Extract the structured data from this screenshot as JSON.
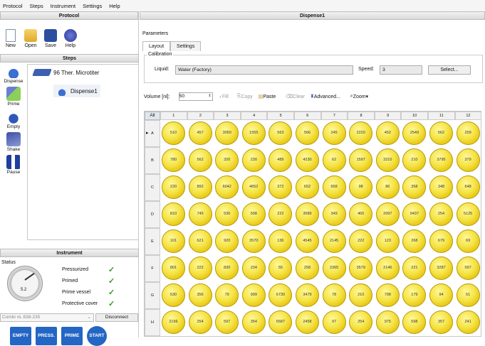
{
  "menu": [
    "Protocol",
    "Steps",
    "Instrument",
    "Settings",
    "Help"
  ],
  "left": {
    "protocol_title": "Protocol",
    "tools": [
      {
        "label": "New",
        "icon": "new-file-icon"
      },
      {
        "label": "Open",
        "icon": "open-folder-icon"
      },
      {
        "label": "Save",
        "icon": "save-disk-icon"
      },
      {
        "label": "Help",
        "icon": "help-icon"
      }
    ],
    "steps_title": "Steps",
    "step_buttons": [
      {
        "label": "Dispense",
        "icon": "dispense-icon"
      },
      {
        "label": "Prime",
        "icon": "prime-icon"
      },
      {
        "label": "Empty",
        "icon": "empty-icon"
      },
      {
        "label": "Shake",
        "icon": "shake-icon"
      },
      {
        "label": "Pause",
        "icon": "pause-icon"
      }
    ],
    "tree": {
      "plate": "96 Ther. Microtiter",
      "step": "Dispense1"
    },
    "instrument_title": "Instrument",
    "status_label": "Status",
    "gauge_value": "5.2",
    "status_items": [
      "Pressurized",
      "Primed",
      "Prime vessel",
      "Protective cover"
    ],
    "device": "Combi nL 838-235",
    "disconnect": "Disconnect",
    "big_buttons": [
      "EMPTY",
      "PRESS.",
      "PRIME",
      "START"
    ],
    "colors": {
      "button_blue": "#2366c4",
      "check_green": "#3a9b27",
      "well_yellow": "#f5e447"
    }
  },
  "right": {
    "title": "Dispense1",
    "parameters_label": "Parameters",
    "tabs": [
      "Layout",
      "Settings"
    ],
    "calibration_label": "Calibration",
    "liquid_label": "Liquid:",
    "liquid_value": "Water (Factory)",
    "speed_label": "Speed:",
    "speed_value": "3",
    "select_button": "Select...",
    "volume_label": "Volume [nl]:",
    "volume_value": "50",
    "toolbar": {
      "fill": "Fill",
      "copy": "Copy",
      "paste": "Paste",
      "clear": "Clear",
      "advanced": "Advanced...",
      "zoom": "Zoom"
    },
    "grid": {
      "corner": "All",
      "columns": [
        "1",
        "2",
        "3",
        "4",
        "5",
        "6",
        "7",
        "8",
        "9",
        "10",
        "11",
        "12"
      ],
      "rows": [
        "A",
        "B",
        "C",
        "D",
        "E",
        "F",
        "G",
        "H"
      ],
      "values": [
        [
          510,
          457,
          3050,
          1555,
          563,
          566,
          245,
          2220,
          452,
          2549,
          562,
          259
        ],
        [
          780,
          562,
          320,
          230,
          489,
          4230,
          62,
          1597,
          3210,
          210,
          3795,
          379
        ],
        [
          220,
          892,
          6042,
          4652,
          372,
          652,
          658,
          98,
          86,
          358,
          348,
          648
        ],
        [
          810,
          745,
          530,
          598,
          222,
          3589,
          349,
          465,
          2697,
          9437,
          254,
          5125
        ],
        [
          101,
          621,
          920,
          3570,
          136,
          4545,
          2145,
          222,
          123,
          268,
          679,
          69
        ],
        [
          801,
          222,
          830,
          234,
          55,
          258,
          2365,
          3579,
          2146,
          221,
          3287,
          597
        ],
        [
          530,
          356,
          79,
          999,
          6730,
          3479,
          78,
          210,
          798,
          179,
          94,
          51
        ],
        [
          2156,
          254,
          597,
          354,
          6587,
          2458,
          97,
          254,
          975,
          598,
          357,
          241
        ]
      ]
    }
  }
}
